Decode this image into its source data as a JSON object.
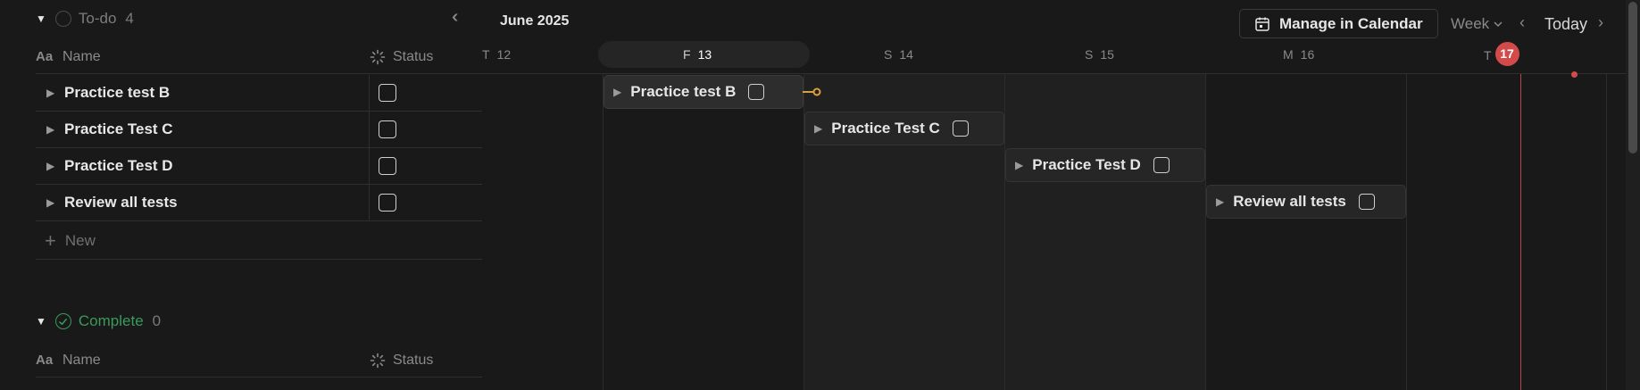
{
  "sidebar": {
    "todo_group": {
      "label": "To-do",
      "count": "4"
    },
    "complete_group": {
      "label": "Complete",
      "count": "0"
    },
    "columns": {
      "name": "Name",
      "status": "Status"
    },
    "rows": [
      {
        "name": "Practice test B"
      },
      {
        "name": "Practice Test C"
      },
      {
        "name": "Practice Test D"
      },
      {
        "name": "Review all tests"
      }
    ],
    "new_label": "New"
  },
  "timeline": {
    "month": "June 2025",
    "manage_label": "Manage in Calendar",
    "view_label": "Week",
    "today_label": "Today",
    "days": [
      {
        "letter": "T",
        "num": "12"
      },
      {
        "letter": "F",
        "num": "13"
      },
      {
        "letter": "S",
        "num": "14"
      },
      {
        "letter": "S",
        "num": "15"
      },
      {
        "letter": "M",
        "num": "16"
      },
      {
        "letter": "T",
        "num": "17"
      }
    ],
    "bars": [
      {
        "name": "Practice test B"
      },
      {
        "name": "Practice Test C"
      },
      {
        "name": "Practice Test D"
      },
      {
        "name": "Review all tests"
      }
    ]
  },
  "colors": {
    "today": "#d24a4a",
    "complete": "#3a9a5b",
    "connector": "#d9a13b"
  }
}
